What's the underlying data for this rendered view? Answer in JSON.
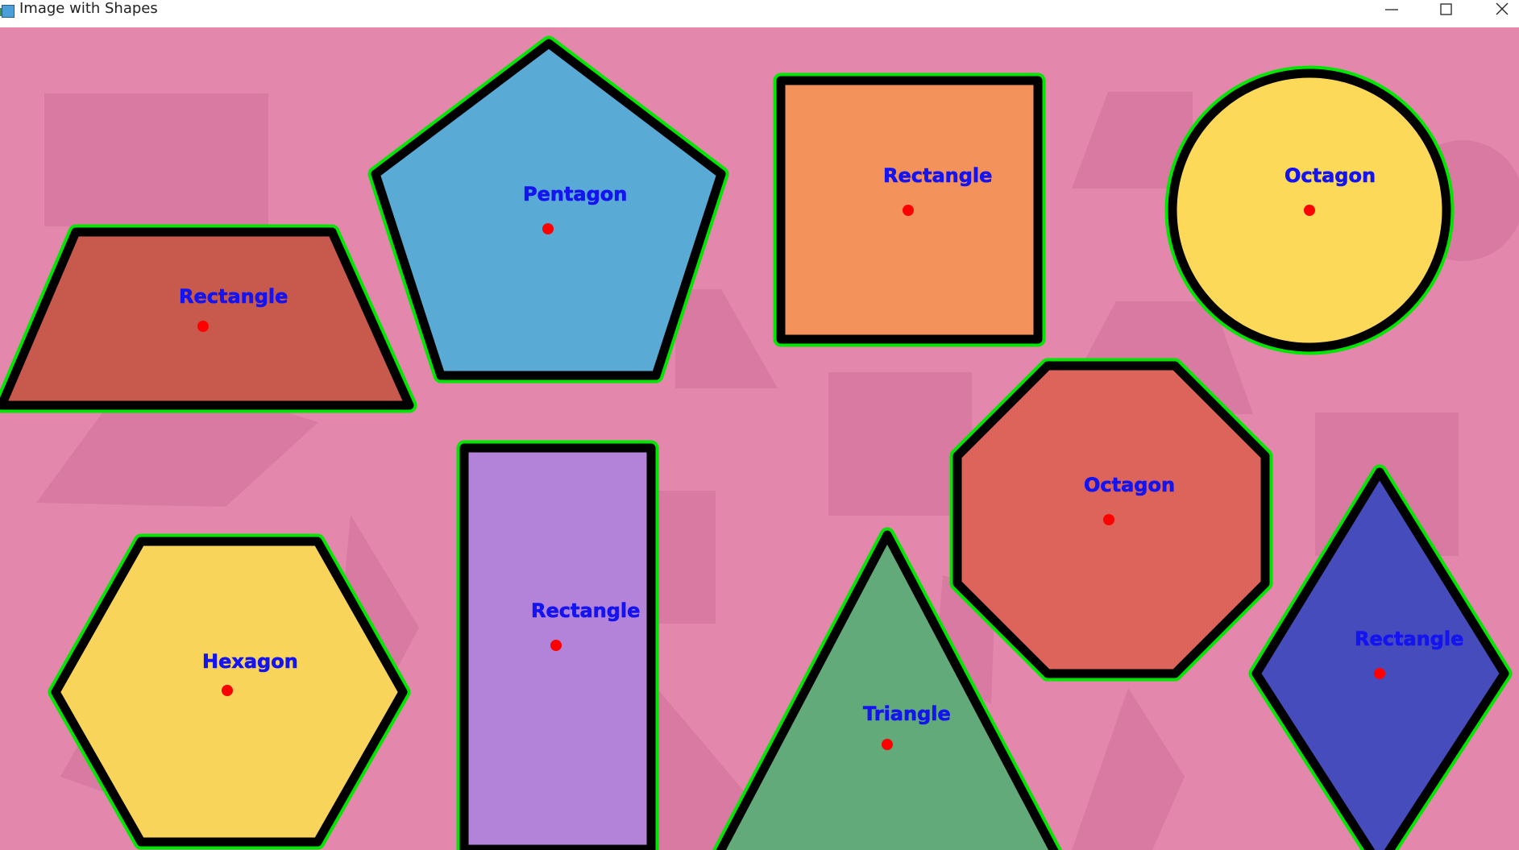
{
  "window": {
    "title": "Image with Shapes",
    "controls": {
      "minimize": "minimize-icon",
      "maximize": "maximize-icon",
      "close": "close-icon"
    }
  },
  "colors": {
    "background": "#e387ad",
    "ghost": "#d87aa2",
    "outline": "#000000",
    "contour": "#00e600",
    "label": "#1414f0",
    "centroid": "#ff0000"
  },
  "shapes": [
    {
      "label": "Rectangle",
      "fill": "#c85a4d"
    },
    {
      "label": "Pentagon",
      "fill": "#5aaad6"
    },
    {
      "label": "Rectangle",
      "fill": "#f3925a"
    },
    {
      "label": "Octagon",
      "fill": "#fdd95a"
    },
    {
      "label": "Hexagon",
      "fill": "#f8d45a"
    },
    {
      "label": "Rectangle",
      "fill": "#b383da"
    },
    {
      "label": "Triangle",
      "fill": "#62aa7a"
    },
    {
      "label": "Octagon",
      "fill": "#dc645a"
    },
    {
      "label": "Rectangle",
      "fill": "#464cbc"
    }
  ]
}
